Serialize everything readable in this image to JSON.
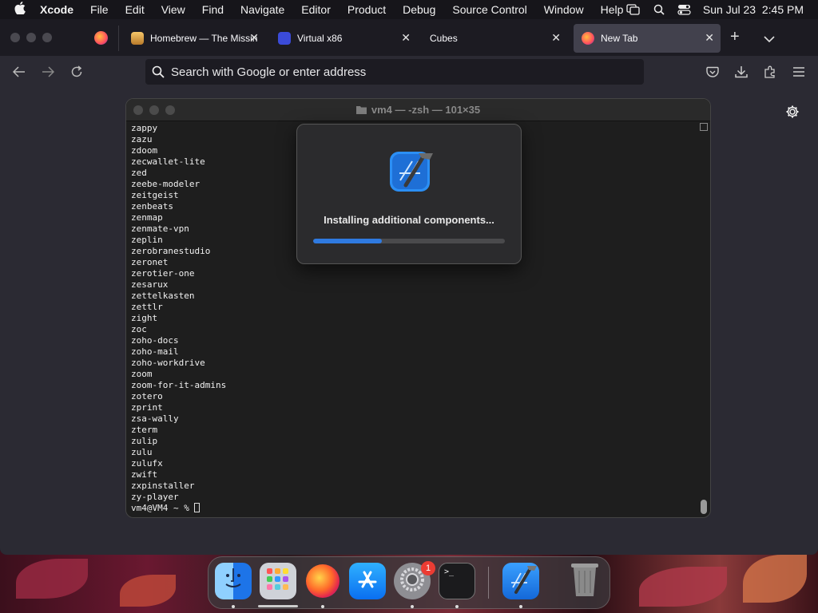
{
  "menubar": {
    "app": "Xcode",
    "items": [
      "File",
      "Edit",
      "View",
      "Find",
      "Navigate",
      "Editor",
      "Product",
      "Debug",
      "Source Control",
      "Window",
      "Help"
    ],
    "datetime": "Sun Jul 23  2:45 PM",
    "status_icons": [
      "screen-mirroring-icon",
      "search-icon",
      "control-center-icon"
    ]
  },
  "browser": {
    "tabs": [
      {
        "label": "Homebrew — The Missin",
        "icon": "homebrew-icon",
        "active": false
      },
      {
        "label": "Virtual x86",
        "icon": "virtual-x86-icon",
        "active": false
      },
      {
        "label": "Cubes",
        "icon": "",
        "active": false
      },
      {
        "label": "New Tab",
        "icon": "firefox-icon",
        "active": true
      }
    ],
    "close_glyph": "✕",
    "new_tab_glyph": "+",
    "tab_list_glyph": "⌄",
    "urlbar": {
      "placeholder": "Search with Google or enter address",
      "value": ""
    }
  },
  "terminal": {
    "title": "vm4 — -zsh — 101×35",
    "lines": [
      "zappy",
      "zazu",
      "zdoom",
      "zecwallet-lite",
      "zed",
      "zeebe-modeler",
      "zeitgeist",
      "zenbeats",
      "zenmap",
      "zenmate-vpn",
      "zeplin",
      "zerobranestudio",
      "zeronet",
      "zerotier-one",
      "zesarux",
      "zettelkasten",
      "zettlr",
      "zight",
      "zoc",
      "zoho-docs",
      "zoho-mail",
      "zoho-workdrive",
      "zoom",
      "zoom-for-it-admins",
      "zotero",
      "zprint",
      "zsa-wally",
      "zterm",
      "zulip",
      "zulu",
      "zulufx",
      "zwift",
      "zxpinstaller",
      "zy-player"
    ],
    "prompt": "vm4@VM4 ~ % "
  },
  "dialog": {
    "message": "Installing additional components...",
    "progress": 0.36
  },
  "dock": {
    "items": [
      {
        "name": "finder",
        "running": true
      },
      {
        "name": "launchpad",
        "running": false
      },
      {
        "name": "firefox",
        "running": true
      },
      {
        "name": "app-store",
        "running": false
      },
      {
        "name": "system-settings",
        "running": true,
        "badge": "1"
      },
      {
        "name": "terminal",
        "running": true
      },
      {
        "name": "xcode",
        "running": true
      },
      {
        "name": "trash",
        "running": false
      }
    ]
  },
  "colors": {
    "accent": "#2f7ae0",
    "badge": "#ec3c33"
  }
}
